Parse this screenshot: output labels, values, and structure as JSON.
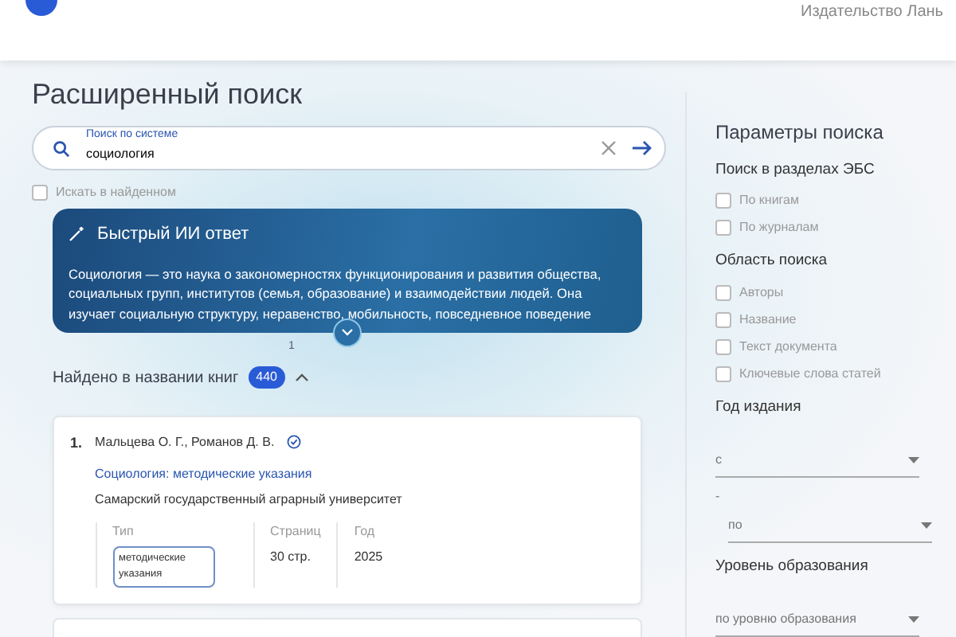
{
  "header": {
    "publisher": "Издательство Лань"
  },
  "title": "Расширенный поиск",
  "search": {
    "label": "Поиск по системе",
    "value": "социология"
  },
  "search_in_results": {
    "label": "Искать в найденном",
    "checked": false
  },
  "ai_answer": {
    "title": "Быстрый ИИ ответ",
    "text": "Социология — это наука о закономерностях функционирования и развития общества, социальных групп, институтов (семья, образование) и взаимодействии людей. Она изучает социальную структуру, неравенство, мобильность, повседневное поведение",
    "expanded": false,
    "page": "1"
  },
  "results_section": {
    "title": "Найдено в названии книг",
    "count": "440",
    "expanded": true
  },
  "results": [
    {
      "number": "1.",
      "authors": "Мальцева О. Г., Романов Д. В.",
      "verified": true,
      "title": "Социология: методические указания",
      "publisher": "Самарский государственный аграрный университет",
      "fields": [
        {
          "label": "Тип",
          "value": "методические указания",
          "kind": "tag"
        },
        {
          "label": "Страниц",
          "value": "30 стр.",
          "kind": "text"
        },
        {
          "label": "Год",
          "value": "2025",
          "kind": "text"
        }
      ]
    }
  ],
  "sidebar": {
    "title": "Параметры поиска",
    "groups": [
      {
        "title": "Поиск в разделах ЭБС",
        "kind": "checkboxes",
        "items": [
          {
            "label": "По книгам",
            "checked": false
          },
          {
            "label": "По журналам",
            "checked": false
          }
        ]
      },
      {
        "title": "Область поиска",
        "kind": "checkboxes",
        "items": [
          {
            "label": "Авторы",
            "checked": false
          },
          {
            "label": "Название",
            "checked": false
          },
          {
            "label": "Текст документа",
            "checked": false
          },
          {
            "label": "Ключевые слова статей",
            "checked": false
          }
        ]
      },
      {
        "title": "Год издания",
        "kind": "range",
        "from": "с",
        "separator": "-",
        "to": "по"
      },
      {
        "title": "Уровень образования",
        "kind": "select",
        "placeholder": "по уровню образования"
      }
    ]
  }
}
